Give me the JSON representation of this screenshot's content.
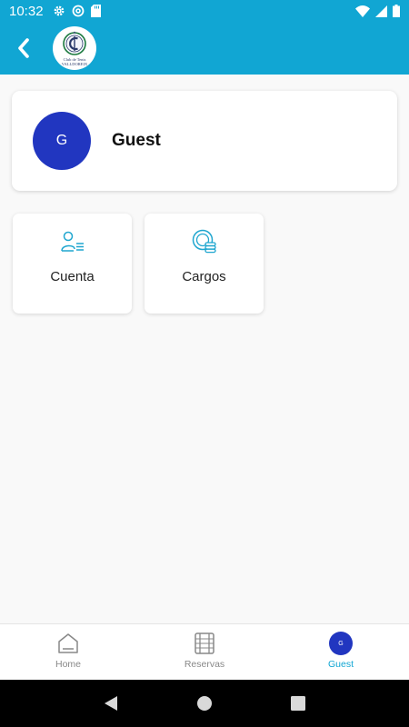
{
  "status_bar": {
    "time": "10:32",
    "left_icons": [
      "settings-icon",
      "at-sign-icon",
      "sd-card-icon"
    ],
    "right_icons": [
      "wifi-icon",
      "signal-icon",
      "battery-icon"
    ]
  },
  "app_bar": {
    "back_icon": "chevron-left-icon",
    "logo_line1": "Club de Tenis",
    "logo_line2": "VALLDOREIX",
    "background": "#11a6d3"
  },
  "profile": {
    "initial": "G",
    "name": "Guest",
    "avatar_color": "#2136c0"
  },
  "tiles": [
    {
      "label": "Cuenta",
      "icon": "user-list-icon"
    },
    {
      "label": "Cargos",
      "icon": "coins-icon"
    }
  ],
  "bottom_nav": {
    "items": [
      {
        "label": "Home",
        "icon": "home-icon",
        "active": false
      },
      {
        "label": "Reservas",
        "icon": "calendar-film-icon",
        "active": false
      },
      {
        "label": "Guest",
        "icon": "avatar",
        "initial": "G",
        "active": true
      }
    ],
    "active_color": "#11a6d3"
  },
  "system_nav": [
    "back-triangle-icon",
    "home-circle-icon",
    "recents-square-icon"
  ]
}
